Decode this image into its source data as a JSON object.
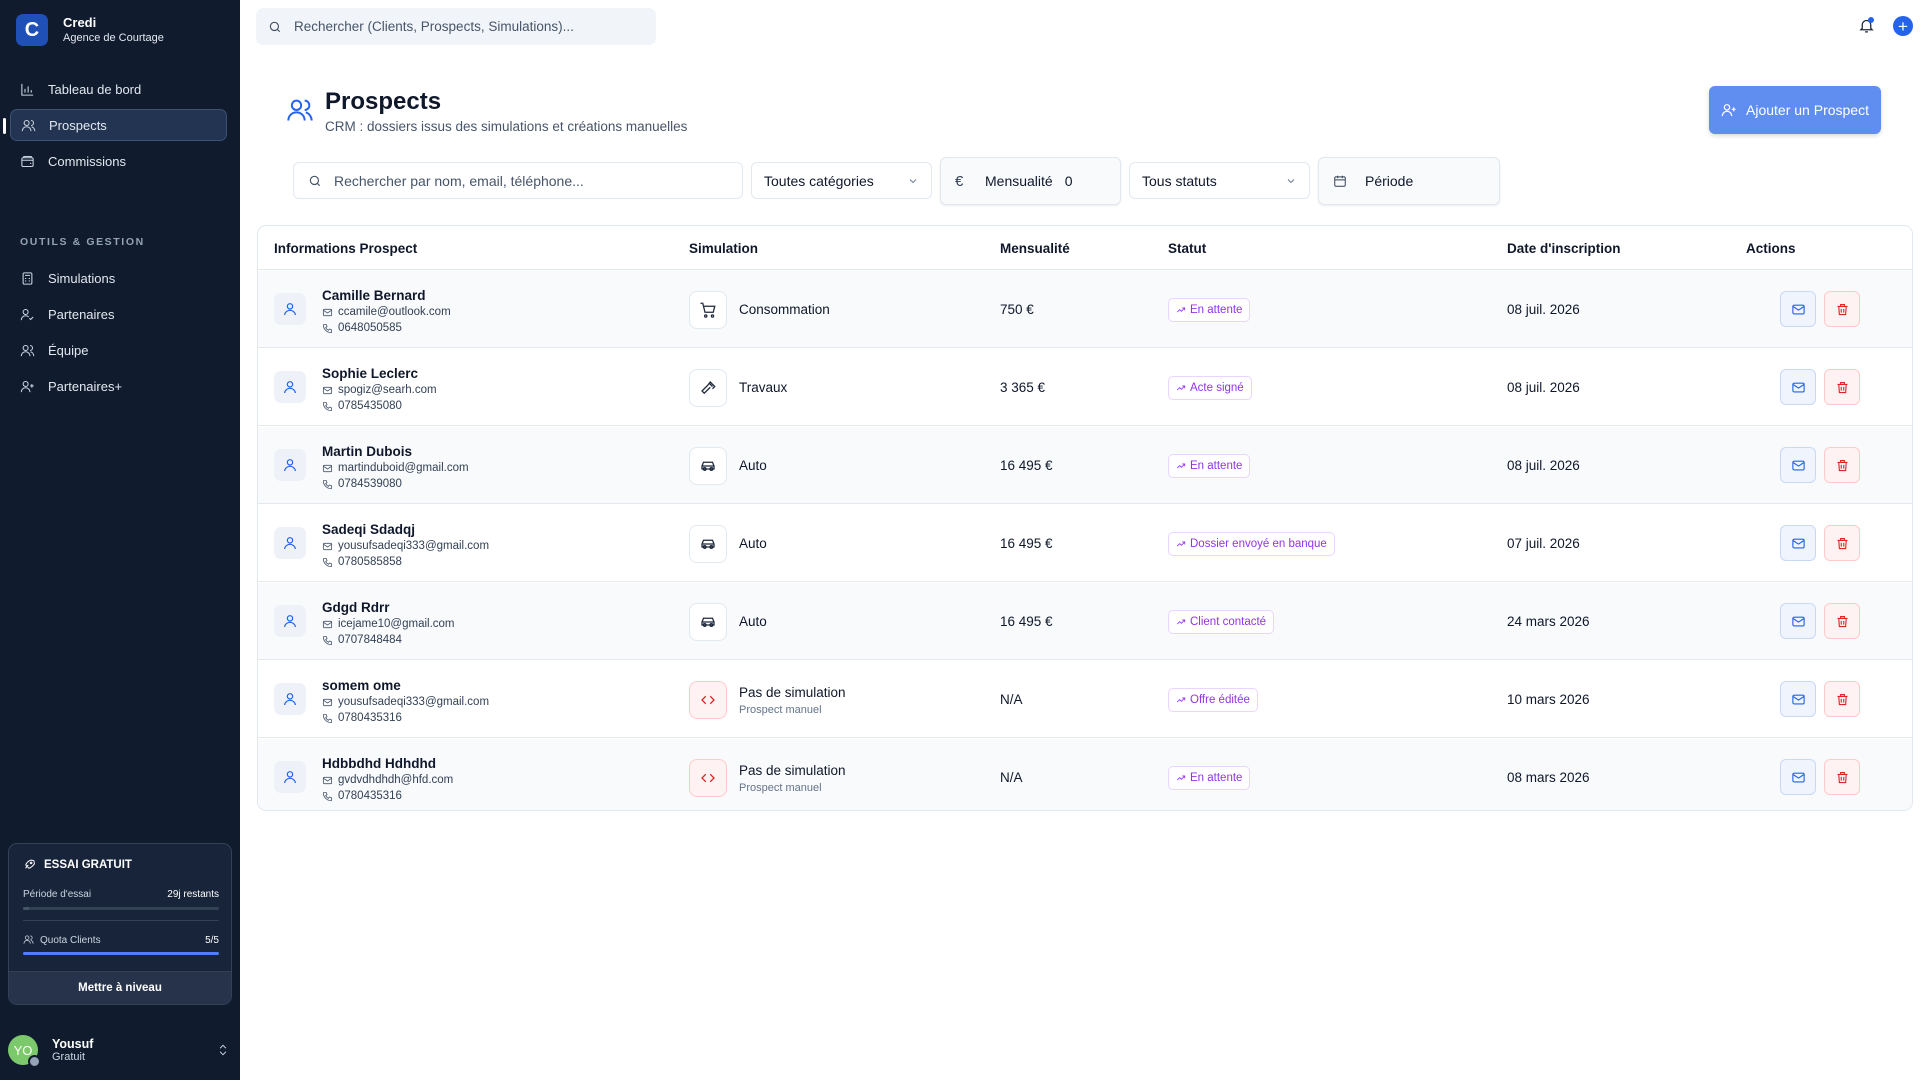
{
  "brand": {
    "name": "Credi",
    "subtitle": "Agence de Courtage",
    "logo_letter": "C"
  },
  "nav": [
    {
      "label": "Tableau de bord",
      "icon": "chart-icon",
      "active": false
    },
    {
      "label": "Prospects",
      "icon": "users-icon",
      "active": true
    },
    {
      "label": "Commissions",
      "icon": "wallet-icon",
      "active": false
    }
  ],
  "nav_section": "OUTILS & GESTION",
  "tools": [
    {
      "label": "Simulations",
      "icon": "calculator-icon"
    },
    {
      "label": "Partenaires",
      "icon": "handshake-icon"
    },
    {
      "label": "Équipe",
      "icon": "team-icon"
    },
    {
      "label": "Partenaires+",
      "icon": "user-plus-icon"
    }
  ],
  "trial": {
    "title": "ESSAI GRATUIT",
    "period_label": "Période d'essai",
    "period_value": "29j restants",
    "period_progress": 0.03,
    "quota_label": "Quota Clients",
    "quota_value": "5/5",
    "quota_progress": 1.0,
    "upgrade_label": "Mettre à niveau"
  },
  "user": {
    "initials": "YO",
    "name": "Yousuf",
    "plan": "Gratuit"
  },
  "topbar": {
    "search_placeholder": "Rechercher (Clients, Prospects, Simulations)..."
  },
  "header": {
    "title": "Prospects",
    "subtitle": "CRM : dossiers issus des simulations et créations manuelles",
    "add_button": "Ajouter un Prospect"
  },
  "filters": {
    "search_placeholder": "Rechercher par nom, email, téléphone...",
    "category": "Toutes catégories",
    "monthly_label": "Mensualité",
    "monthly_value": "0",
    "currency_symbol": "€",
    "status": "Tous statuts",
    "period": "Période"
  },
  "columns": [
    "Informations Prospect",
    "Simulation",
    "Mensualité",
    "Statut",
    "Date d'inscription",
    "Actions"
  ],
  "colors": {
    "accent": "#2563eb",
    "sidebar": "#101b2d",
    "badge": "#9333ea",
    "danger": "#dc2626"
  },
  "rows": [
    {
      "name": "Camille Bernard",
      "email": "ccamile@outlook.com",
      "phone": "0648050585",
      "sim_icon": "cart-icon",
      "simulation": "Consommation",
      "sim_sub": "",
      "amount": "750 €",
      "status": "En attente",
      "date": "08 juil. 2026"
    },
    {
      "name": "Sophie Leclerc",
      "email": "spogiz@searh.com",
      "phone": "0785435080",
      "sim_icon": "hammer-icon",
      "simulation": "Travaux",
      "sim_sub": "",
      "amount": "3 365 €",
      "status": "Acte signé",
      "date": "08 juil. 2026"
    },
    {
      "name": "Martin Dubois",
      "email": "martinduboid@gmail.com",
      "phone": "0784539080",
      "sim_icon": "car-icon",
      "simulation": "Auto",
      "sim_sub": "",
      "amount": "16 495 €",
      "status": "En attente",
      "date": "08 juil. 2026"
    },
    {
      "name": "Sadeqi Sdadqj",
      "email": "yousufsadeqi333@gmail.com",
      "phone": "0780585858",
      "sim_icon": "car-icon",
      "simulation": "Auto",
      "sim_sub": "",
      "amount": "16 495 €",
      "status": "Dossier envoyé en banque",
      "date": "07 juil. 2026"
    },
    {
      "name": "Gdgd Rdrr",
      "email": "icejame10@gmail.com",
      "phone": "0707848484",
      "sim_icon": "car-icon",
      "simulation": "Auto",
      "sim_sub": "",
      "amount": "16 495 €",
      "status": "Client contacté",
      "date": "24 mars 2026"
    },
    {
      "name": "somem ome",
      "email": "yousufsadeqi333@gmail.com",
      "phone": "0780435316",
      "sim_icon": "code-icon",
      "simulation": "Pas de simulation",
      "sim_sub": "Prospect manuel",
      "amount": "N/A",
      "status": "Offre éditée",
      "date": "10 mars 2026"
    },
    {
      "name": "Hdbbdhd Hdhdhd",
      "email": "gvdvdhdhdh@hfd.com",
      "phone": "0780435316",
      "sim_icon": "code-icon",
      "simulation": "Pas de simulation",
      "sim_sub": "Prospect manuel",
      "amount": "N/A",
      "status": "En attente",
      "date": "08 mars 2026"
    }
  ]
}
